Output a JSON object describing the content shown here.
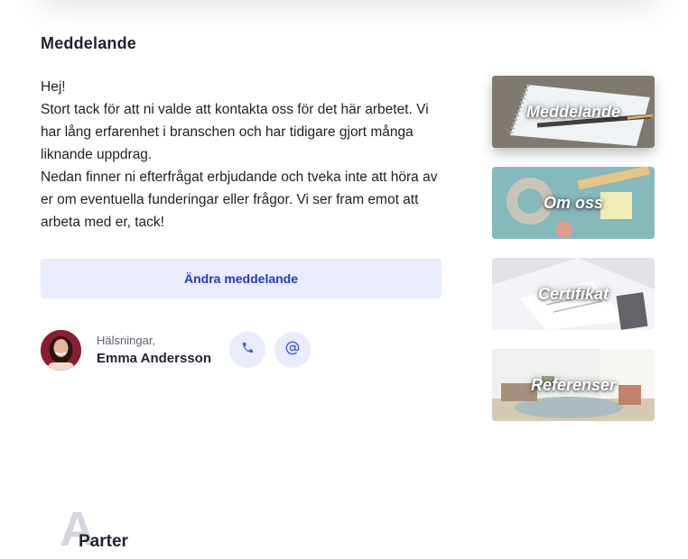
{
  "section": {
    "title": "Meddelande"
  },
  "message": {
    "paragraphs": [
      "Hej!",
      "Stort tack för att ni valde att kontakta oss för det här arbetet. Vi har lång erfarenhet i branschen och har tidigare gjort många liknande uppdrag.",
      "Nedan finner ni efterfrågat erbjudande och tveka inte att höra av er om eventuella funderingar eller frågor. Vi ser fram emot att arbeta med er, tack!"
    ]
  },
  "edit_button": {
    "label": "Ändra meddelande"
  },
  "signature": {
    "greeting": "Hälsningar,",
    "name": "Emma Andersson"
  },
  "contact": {
    "phone_icon": "phone-icon",
    "email_icon": "at-sign-icon"
  },
  "tiles": [
    {
      "label": "Meddelande",
      "active": true
    },
    {
      "label": "Om oss",
      "active": false
    },
    {
      "label": "Certifikat",
      "active": false
    },
    {
      "label": "Referenser",
      "active": false
    }
  ],
  "parties": {
    "letter": "A",
    "label": "Parter"
  },
  "colors": {
    "accent": "#2138c6",
    "accent_bg": "#e8ecfd",
    "text": "#1f2330"
  }
}
